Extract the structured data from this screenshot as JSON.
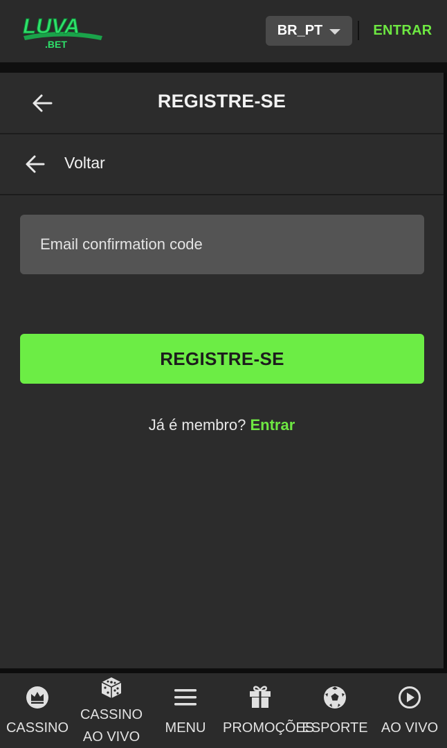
{
  "header": {
    "logo_text": "LUVA",
    "logo_sub": ".BET",
    "language": "BR_PT",
    "login_label": "ENTRAR",
    "accent_color": "#6ee842"
  },
  "panel": {
    "title": "REGISTRE-SE",
    "back_label": "Voltar",
    "code_input": {
      "value": "",
      "placeholder": "Email confirmation code"
    },
    "submit_label": "REGISTRE-SE",
    "member_text": "Já é membro?",
    "member_link": "Entrar",
    "button_color": "#6ced45"
  },
  "bottom_nav": {
    "items": [
      {
        "icon": "crown-icon",
        "label": "CASSINO"
      },
      {
        "icon": "dice-icon",
        "label_line1": "CASSINO",
        "label_line2": "AO VIVO"
      },
      {
        "icon": "menu-icon",
        "label": "MENU"
      },
      {
        "icon": "gift-icon",
        "label": "PROMOÇÕES"
      },
      {
        "icon": "soccer-ball-icon",
        "label": "ESPORTE"
      },
      {
        "icon": "play-circle-icon",
        "label": "AO VIVO"
      }
    ]
  }
}
